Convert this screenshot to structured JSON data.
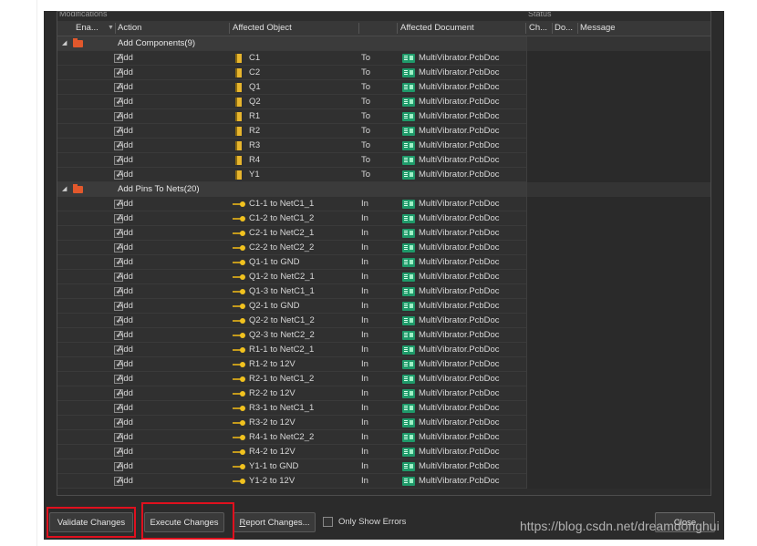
{
  "panel": {
    "modifications_label": "Modifications",
    "status_label": "Status"
  },
  "columns": {
    "enable": "Ena...",
    "action": "Action",
    "affected_object": "Affected Object",
    "affected_document": "Affected Document",
    "check": "Ch...",
    "done": "Do...",
    "message": "Message"
  },
  "groups": [
    {
      "label": "Add Components(9)",
      "icon": "folder-icon",
      "rows": [
        {
          "action": "Add",
          "object": "C1",
          "dir": "To",
          "doc": "MultiVibrator.PcbDoc",
          "icon": "component-icon"
        },
        {
          "action": "Add",
          "object": "C2",
          "dir": "To",
          "doc": "MultiVibrator.PcbDoc",
          "icon": "component-icon"
        },
        {
          "action": "Add",
          "object": "Q1",
          "dir": "To",
          "doc": "MultiVibrator.PcbDoc",
          "icon": "component-icon"
        },
        {
          "action": "Add",
          "object": "Q2",
          "dir": "To",
          "doc": "MultiVibrator.PcbDoc",
          "icon": "component-icon"
        },
        {
          "action": "Add",
          "object": "R1",
          "dir": "To",
          "doc": "MultiVibrator.PcbDoc",
          "icon": "component-icon"
        },
        {
          "action": "Add",
          "object": "R2",
          "dir": "To",
          "doc": "MultiVibrator.PcbDoc",
          "icon": "component-icon"
        },
        {
          "action": "Add",
          "object": "R3",
          "dir": "To",
          "doc": "MultiVibrator.PcbDoc",
          "icon": "component-icon"
        },
        {
          "action": "Add",
          "object": "R4",
          "dir": "To",
          "doc": "MultiVibrator.PcbDoc",
          "icon": "component-icon"
        },
        {
          "action": "Add",
          "object": "Y1",
          "dir": "To",
          "doc": "MultiVibrator.PcbDoc",
          "icon": "component-icon"
        }
      ]
    },
    {
      "label": "Add Pins To Nets(20)",
      "icon": "folder-icon",
      "rows": [
        {
          "action": "Add",
          "object": "C1-1 to NetC1_1",
          "dir": "In",
          "doc": "MultiVibrator.PcbDoc",
          "icon": "pin-icon"
        },
        {
          "action": "Add",
          "object": "C1-2 to NetC1_2",
          "dir": "In",
          "doc": "MultiVibrator.PcbDoc",
          "icon": "pin-icon"
        },
        {
          "action": "Add",
          "object": "C2-1 to NetC2_1",
          "dir": "In",
          "doc": "MultiVibrator.PcbDoc",
          "icon": "pin-icon"
        },
        {
          "action": "Add",
          "object": "C2-2 to NetC2_2",
          "dir": "In",
          "doc": "MultiVibrator.PcbDoc",
          "icon": "pin-icon"
        },
        {
          "action": "Add",
          "object": "Q1-1 to GND",
          "dir": "In",
          "doc": "MultiVibrator.PcbDoc",
          "icon": "pin-icon"
        },
        {
          "action": "Add",
          "object": "Q1-2 to NetC2_1",
          "dir": "In",
          "doc": "MultiVibrator.PcbDoc",
          "icon": "pin-icon"
        },
        {
          "action": "Add",
          "object": "Q1-3 to NetC1_1",
          "dir": "In",
          "doc": "MultiVibrator.PcbDoc",
          "icon": "pin-icon"
        },
        {
          "action": "Add",
          "object": "Q2-1 to GND",
          "dir": "In",
          "doc": "MultiVibrator.PcbDoc",
          "icon": "pin-icon"
        },
        {
          "action": "Add",
          "object": "Q2-2 to NetC1_2",
          "dir": "In",
          "doc": "MultiVibrator.PcbDoc",
          "icon": "pin-icon"
        },
        {
          "action": "Add",
          "object": "Q2-3 to NetC2_2",
          "dir": "In",
          "doc": "MultiVibrator.PcbDoc",
          "icon": "pin-icon"
        },
        {
          "action": "Add",
          "object": "R1-1 to NetC2_1",
          "dir": "In",
          "doc": "MultiVibrator.PcbDoc",
          "icon": "pin-icon"
        },
        {
          "action": "Add",
          "object": "R1-2 to 12V",
          "dir": "In",
          "doc": "MultiVibrator.PcbDoc",
          "icon": "pin-icon"
        },
        {
          "action": "Add",
          "object": "R2-1 to NetC1_2",
          "dir": "In",
          "doc": "MultiVibrator.PcbDoc",
          "icon": "pin-icon"
        },
        {
          "action": "Add",
          "object": "R2-2 to 12V",
          "dir": "In",
          "doc": "MultiVibrator.PcbDoc",
          "icon": "pin-icon"
        },
        {
          "action": "Add",
          "object": "R3-1 to NetC1_1",
          "dir": "In",
          "doc": "MultiVibrator.PcbDoc",
          "icon": "pin-icon"
        },
        {
          "action": "Add",
          "object": "R3-2 to 12V",
          "dir": "In",
          "doc": "MultiVibrator.PcbDoc",
          "icon": "pin-icon"
        },
        {
          "action": "Add",
          "object": "R4-1 to NetC2_2",
          "dir": "In",
          "doc": "MultiVibrator.PcbDoc",
          "icon": "pin-icon"
        },
        {
          "action": "Add",
          "object": "R4-2 to 12V",
          "dir": "In",
          "doc": "MultiVibrator.PcbDoc",
          "icon": "pin-icon"
        },
        {
          "action": "Add",
          "object": "Y1-1 to GND",
          "dir": "In",
          "doc": "MultiVibrator.PcbDoc",
          "icon": "pin-icon"
        },
        {
          "action": "Add",
          "object": "Y1-2 to 12V",
          "dir": "In",
          "doc": "MultiVibrator.PcbDoc",
          "icon": "pin-icon"
        }
      ]
    }
  ],
  "buttons": {
    "validate": "Validate Changes",
    "execute": "Execute Changes",
    "report": "Report Changes...",
    "only_show_errors": "Only Show Errors",
    "close": "Close"
  },
  "watermark": "https://blog.csdn.net/dreamdonghui",
  "colors": {
    "highlight_box": "#e0101e",
    "folder": "#e2582c",
    "document_icon": "#1f9a6a",
    "component_icon": "#e7b52d"
  }
}
